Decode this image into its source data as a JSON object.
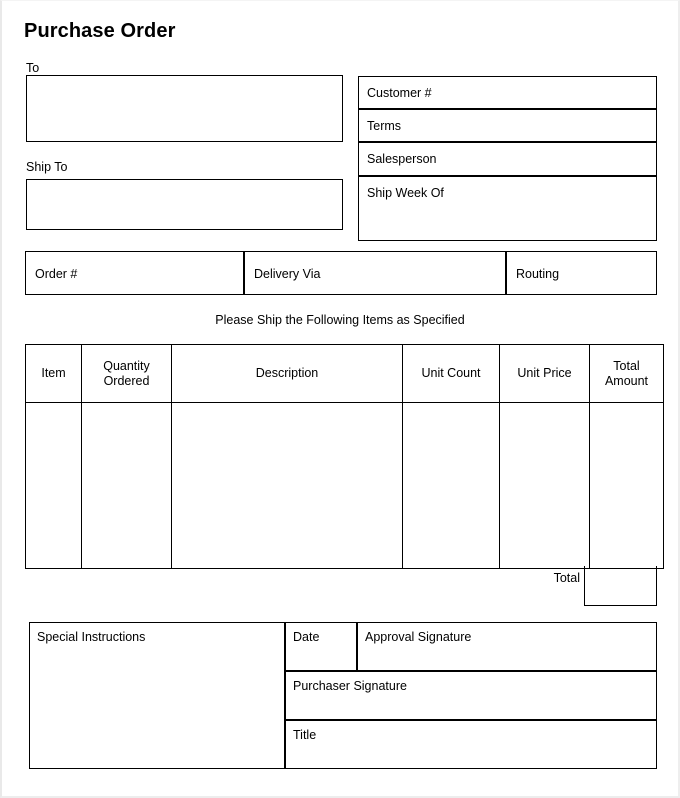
{
  "document": {
    "title": "Purchase Order",
    "instruction_note": "Please Ship the Following Items as Specified"
  },
  "address_block": {
    "to_label": "To",
    "to_value": "",
    "ship_to_label": "Ship To",
    "ship_to_value": ""
  },
  "order_info": {
    "fields": [
      {
        "label": "Customer #",
        "value": ""
      },
      {
        "label": "Terms",
        "value": ""
      },
      {
        "label": "Salesperson",
        "value": ""
      },
      {
        "label": "Ship Week Of",
        "value": ""
      }
    ]
  },
  "order_row": {
    "order_number_label": "Order #",
    "order_number_value": "",
    "delivery_via_label": "Delivery Via",
    "delivery_via_value": "",
    "routing_label": "Routing",
    "routing_value": ""
  },
  "items_table": {
    "columns": [
      "Item",
      "Quantity Ordered",
      "Description",
      "Unit Count",
      "Unit Price",
      "Total Amount"
    ],
    "columns_wrapped": [
      "Item",
      "Quantity\nOrdered",
      "Description",
      "Unit Count",
      "Unit Price",
      "Total\nAmount"
    ],
    "rows": [
      {
        "item": "",
        "quantity_ordered": "",
        "description": "",
        "unit_count": "",
        "unit_price": "",
        "total_amount": ""
      }
    ],
    "total_label": "Total",
    "total_value": ""
  },
  "footer": {
    "special_instructions_label": "Special Instructions",
    "special_instructions_value": "",
    "date_label": "Date",
    "date_value": "",
    "approval_signature_label": "Approval Signature",
    "approval_signature_value": "",
    "purchaser_signature_label": "Purchaser Signature",
    "purchaser_signature_value": "",
    "title_label": "Title",
    "title_value": ""
  },
  "colors": {
    "ink": "#000000",
    "paper": "#ffffff",
    "page_edge": "#e9e9e9"
  }
}
